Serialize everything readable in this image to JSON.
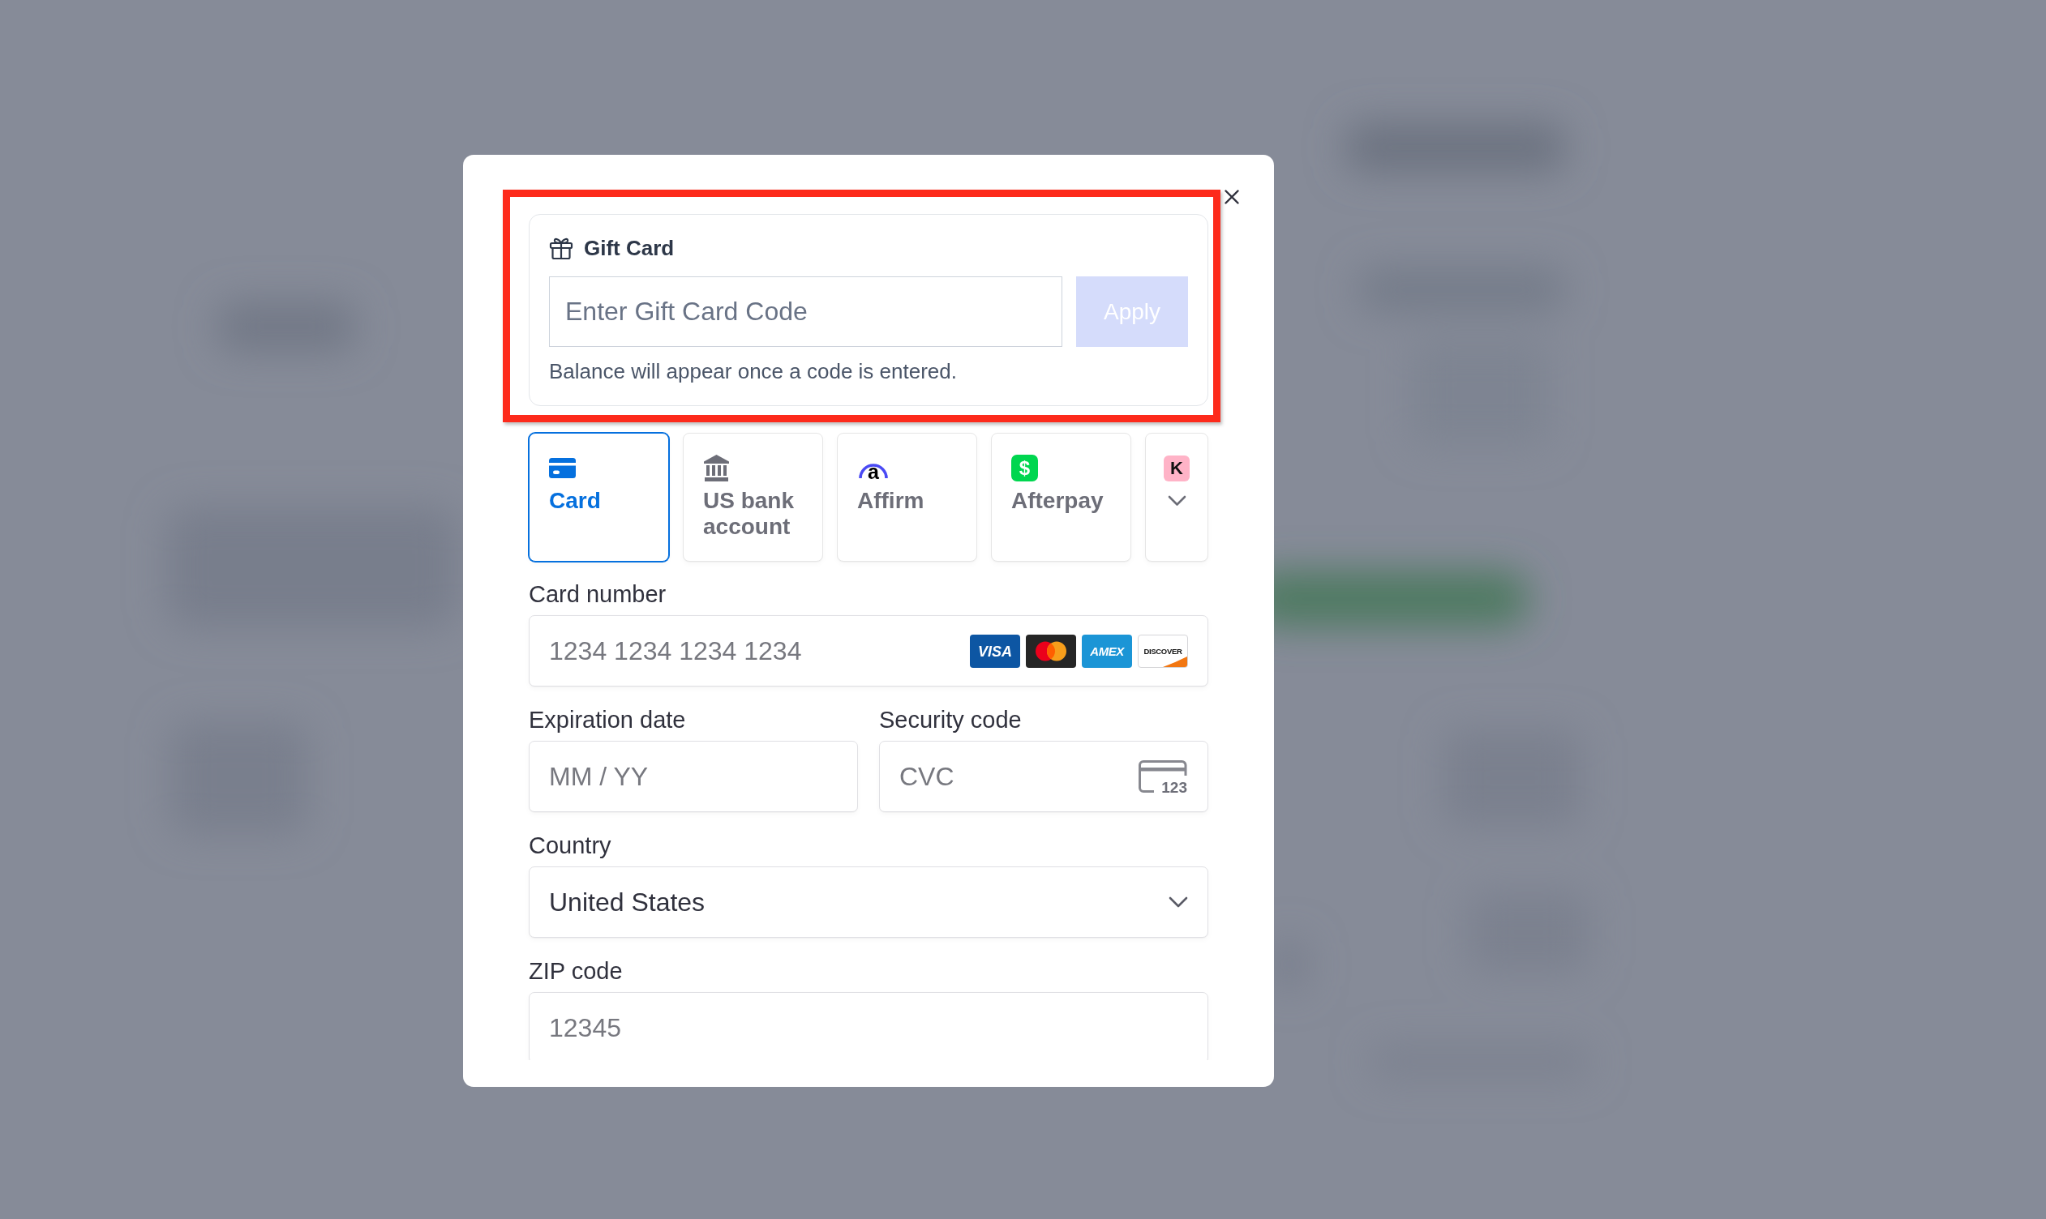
{
  "gift_card": {
    "highlighted": true,
    "title": "Gift Card",
    "code_field": {
      "placeholder": "Enter Gift Card Code"
    },
    "apply_button": {
      "label": "Apply",
      "disabled": true
    },
    "note": "Balance will appear once a code is entered."
  },
  "payment_methods": [
    {
      "kind": "card",
      "label": "Card",
      "selected": true
    },
    {
      "kind": "bank",
      "label": "US bank account",
      "selected": false
    },
    {
      "kind": "affirm",
      "glyph": "a",
      "label": "Affirm",
      "selected": false
    },
    {
      "kind": "cash",
      "glyph": "$",
      "label": "Afterpay",
      "selected": false
    },
    {
      "kind": "more",
      "glyph": "K",
      "selected": false
    }
  ],
  "card_number": {
    "label": "Card number",
    "placeholder": "1234 1234 1234 1234",
    "brands": [
      {
        "kind": "visa",
        "label": "VISA"
      },
      {
        "kind": "mastercard"
      },
      {
        "kind": "amex",
        "label": "AMEX"
      },
      {
        "kind": "discover",
        "label": "DISCOVER"
      }
    ]
  },
  "expiration_date": {
    "label": "Expiration date",
    "placeholder": "MM / YY"
  },
  "security_code": {
    "label": "Security code",
    "placeholder": "CVC",
    "icon_text": "123"
  },
  "country": {
    "label": "Country",
    "value": "United States"
  },
  "zip_code": {
    "label": "ZIP code",
    "placeholder": "12345"
  }
}
